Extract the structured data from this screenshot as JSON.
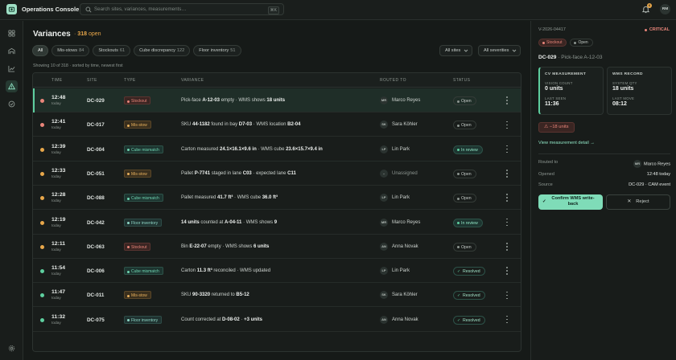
{
  "app": {
    "name": "Operations Console"
  },
  "search": {
    "placeholder": "Search sites, variances, measurements…",
    "shortcut": "⌘K"
  },
  "notifications": {
    "count": "6"
  },
  "user": {
    "initials": "RM"
  },
  "colors": {
    "accent": "#5ecf9f",
    "critical": "#e9857a",
    "warning": "#e8a74a",
    "background": "#161a18"
  },
  "rail": [
    {
      "icon": "dashboard-icon",
      "active": false
    },
    {
      "icon": "warehouse-icon",
      "active": false
    },
    {
      "icon": "analytics-icon",
      "active": false
    },
    {
      "icon": "alert-triangle-icon",
      "active": true
    },
    {
      "icon": "check-circle-icon",
      "active": false
    },
    {
      "icon": "settings-icon",
      "active": false
    }
  ],
  "page": {
    "title": "Variances",
    "separator": "·",
    "open_count": "318",
    "open_label": "open"
  },
  "filters": [
    {
      "label": "All",
      "count": "",
      "active": true
    },
    {
      "label": "Mis-stows",
      "count": "84",
      "active": false
    },
    {
      "label": "Stockouts",
      "count": "61",
      "active": false
    },
    {
      "label": "Cube discrepancy",
      "count": "122",
      "active": false
    },
    {
      "label": "Floor inventory",
      "count": "51",
      "active": false
    }
  ],
  "dropdowns": {
    "sites": "All sites",
    "severities": "All severities"
  },
  "showing": "Showing 10 of 318 · sorted by time, newest first",
  "table": {
    "columns": {
      "time": "TIME",
      "site": "SITE",
      "type": "TYPE",
      "variance": "VARIANCE",
      "routed_to": "ROUTED TO",
      "status": "STATUS"
    },
    "rows": [
      {
        "time": "12:48",
        "day": "today",
        "site": "DC-029",
        "severity": "critical",
        "type": "Stockout",
        "type_key": "stockout",
        "variance": [
          [
            "Pick-face ",
            false
          ],
          [
            "A-12-03",
            true
          ],
          [
            " empty · WMS shows ",
            false
          ],
          [
            "18 units",
            true
          ]
        ],
        "initials": "MR",
        "routed": "Marco Reyes",
        "status": "Open",
        "status_key": "open",
        "selected": true
      },
      {
        "time": "12:41",
        "day": "today",
        "site": "DC-017",
        "severity": "critical",
        "type": "Mis-stow",
        "type_key": "misstow",
        "variance": [
          [
            "SKU ",
            false
          ],
          [
            "44-1182",
            true
          ],
          [
            " found in bay ",
            false
          ],
          [
            "D7-03",
            true
          ],
          [
            " · WMS location ",
            false
          ],
          [
            "B2-04",
            true
          ]
        ],
        "initials": "SK",
        "routed": "Sara Köhler",
        "status": "Open",
        "status_key": "open"
      },
      {
        "time": "12:39",
        "day": "today",
        "site": "DC-004",
        "severity": "warning",
        "type": "Cube mismatch",
        "type_key": "cube",
        "variance": [
          [
            "Carton measured ",
            false
          ],
          [
            "24.1×16.1×9.6 in",
            true
          ],
          [
            " · WMS cube ",
            false
          ],
          [
            "23.6×15.7×9.4 in",
            true
          ]
        ],
        "initials": "LP",
        "routed": "Lin Park",
        "status": "In review",
        "status_key": "review"
      },
      {
        "time": "12:33",
        "day": "today",
        "site": "DC-051",
        "severity": "warning",
        "type": "Mis-stow",
        "type_key": "misstow",
        "variance": [
          [
            "Pallet ",
            false
          ],
          [
            "P-7741",
            true
          ],
          [
            " staged in lane ",
            false
          ],
          [
            "C03",
            true
          ],
          [
            " · expected lane ",
            false
          ],
          [
            "C11",
            true
          ]
        ],
        "initials": "–",
        "routed": "Unassigned",
        "routed_muted": true,
        "status": "Open",
        "status_key": "open"
      },
      {
        "time": "12:28",
        "day": "today",
        "site": "DC-088",
        "severity": "warning",
        "type": "Cube mismatch",
        "type_key": "cube",
        "variance": [
          [
            "Pallet measured ",
            false
          ],
          [
            "41.7 ft³",
            true
          ],
          [
            " · WMS cube ",
            false
          ],
          [
            "36.0 ft³",
            true
          ]
        ],
        "initials": "LP",
        "routed": "Lin Park",
        "status": "Open",
        "status_key": "open"
      },
      {
        "time": "12:19",
        "day": "today",
        "site": "DC-042",
        "severity": "warning",
        "type": "Floor inventory",
        "type_key": "floor",
        "variance": [
          [
            "14 units",
            true
          ],
          [
            " counted at ",
            false
          ],
          [
            "A-04-11",
            true
          ],
          [
            " · WMS shows ",
            false
          ],
          [
            "9",
            true
          ]
        ],
        "initials": "MR",
        "routed": "Marco Reyes",
        "status": "In review",
        "status_key": "review"
      },
      {
        "time": "12:11",
        "day": "today",
        "site": "DC-063",
        "severity": "warning",
        "type": "Stockout",
        "type_key": "stockout",
        "variance": [
          [
            "Bin ",
            false
          ],
          [
            "E-22-07",
            true
          ],
          [
            " empty · WMS shows ",
            false
          ],
          [
            "6 units",
            true
          ]
        ],
        "initials": "AN",
        "routed": "Anna Novak",
        "status": "Open",
        "status_key": "open"
      },
      {
        "time": "11:54",
        "day": "today",
        "site": "DC-006",
        "severity": "resolved",
        "type": "Cube mismatch",
        "type_key": "cube",
        "variance": [
          [
            "Carton ",
            false
          ],
          [
            "11.3 ft³",
            true
          ],
          [
            " reconciled · WMS updated",
            false
          ]
        ],
        "initials": "LP",
        "routed": "Lin Park",
        "status": "Resolved",
        "status_key": "resolved"
      },
      {
        "time": "11:47",
        "day": "today",
        "site": "DC-011",
        "severity": "resolved",
        "type": "Mis-stow",
        "type_key": "misstow",
        "variance": [
          [
            "SKU ",
            false
          ],
          [
            "90-3320",
            true
          ],
          [
            " returned to ",
            false
          ],
          [
            "B5-12",
            true
          ]
        ],
        "initials": "SK",
        "routed": "Sara Köhler",
        "status": "Resolved",
        "status_key": "resolved"
      },
      {
        "time": "11:32",
        "day": "today",
        "site": "DC-075",
        "severity": "resolved",
        "type": "Floor inventory",
        "type_key": "floor",
        "variance": [
          [
            "Count corrected at ",
            false
          ],
          [
            "D-08-02",
            true
          ],
          [
            " · ",
            false
          ],
          [
            "+3 units",
            true
          ]
        ],
        "initials": "AN",
        "routed": "Anna Novak",
        "status": "Resolved",
        "status_key": "resolved"
      }
    ]
  },
  "panel": {
    "id": "V-2026-04417",
    "severity": "CRITICAL",
    "tags": {
      "type": "Stockout",
      "status": "Open"
    },
    "site": "DC-029",
    "separator": "·",
    "location": "Pick-face A-12-03",
    "cv": {
      "title": "CV MEASUREMENT",
      "count_label": "VISION COUNT",
      "count": "0 units",
      "seen_label": "LAST SEEN",
      "seen": "11:36"
    },
    "wms": {
      "title": "WMS RECORD",
      "qty_label": "SYSTEM QTY",
      "qty": "18 units",
      "move_label": "LAST MOVE",
      "move": "08:12"
    },
    "delta": "−18 units",
    "link": "View measurement detail",
    "details": {
      "routed_label": "Routed to",
      "routed_initials": "MR",
      "routed": "Marco Reyes",
      "opened_label": "Opened",
      "opened": "12:48 today",
      "source_label": "Source",
      "source": "DC-029 · CAM event"
    },
    "confirm": "Confirm WMS write-back",
    "reject": "Reject"
  }
}
